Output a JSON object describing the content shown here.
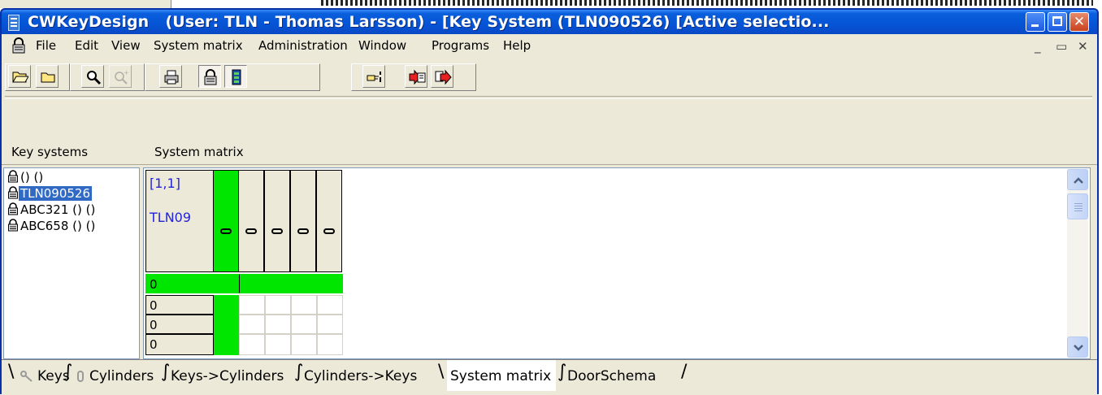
{
  "window": {
    "app_name": "CWKeyDesign",
    "title": "(User: TLN - Thomas Larsson) - [Key System (TLN090526) [Active selectio..."
  },
  "menu": [
    "File",
    "Edit",
    "View",
    "System matrix",
    "Administration",
    "Window",
    "Programs",
    "Help"
  ],
  "mdi_controls": {
    "minimize": "_",
    "restore": "̅❐",
    "close": "×"
  },
  "toolbar": {
    "buttons": [
      "open-folder",
      "folder",
      "zoom-in",
      "zoom-out",
      "print",
      "key-system",
      "system-matrix",
      "pointer",
      "export",
      "import"
    ]
  },
  "panel_headers": {
    "left": "Key systems",
    "right": "System matrix"
  },
  "key_systems": [
    {
      "label": "() ()",
      "selected": false
    },
    {
      "label": "TLN090526",
      "selected": true
    },
    {
      "label": "ABC321 () ()",
      "selected": false
    },
    {
      "label": "ABC658 () ()",
      "selected": false
    }
  ],
  "matrix": {
    "position": "[1,1]",
    "system": "TLN09",
    "row_labels": [
      "0",
      "0",
      "0",
      "0"
    ]
  },
  "tabs": [
    "Keys",
    "Cylinders",
    "Keys->Cylinders",
    "Cylinders->Keys",
    "System matrix",
    "DoorSchema"
  ],
  "active_tab": "System matrix",
  "colors": {
    "highlight_green": "#00e600",
    "selection_blue": "#316ac5",
    "titlebar_blue": "#0554d6"
  }
}
